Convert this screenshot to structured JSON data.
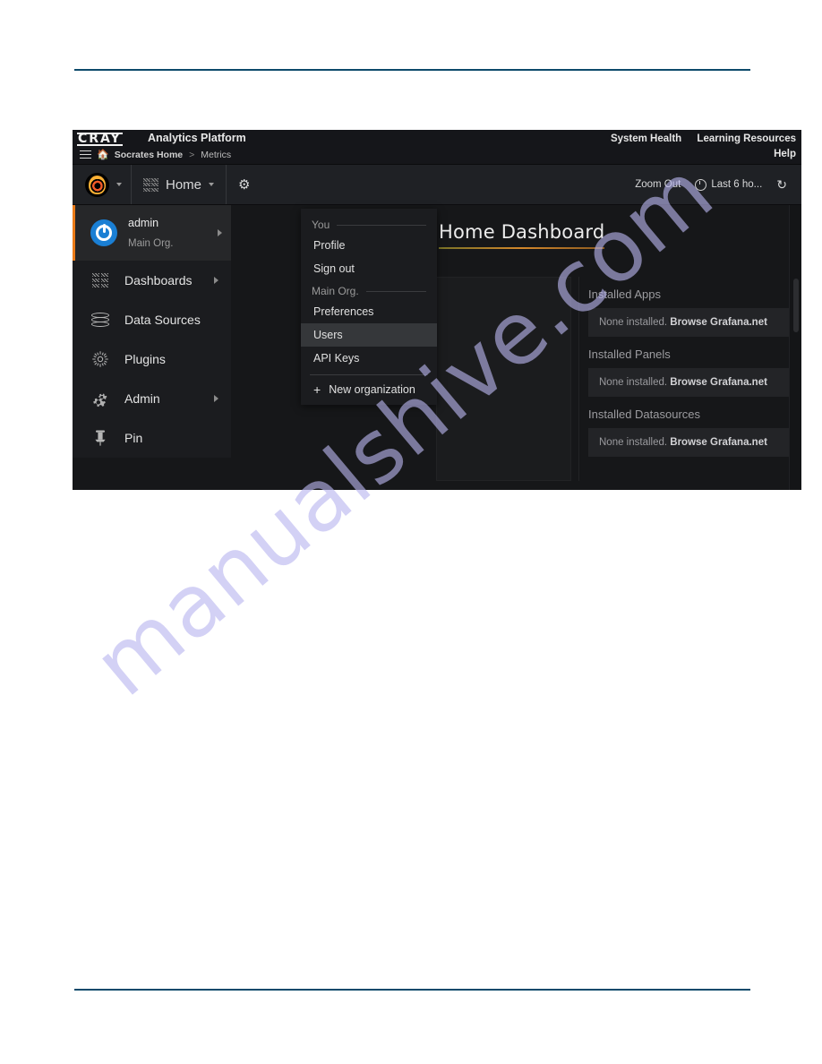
{
  "watermark": {
    "text": "manualshive.com"
  },
  "cray_bar": {
    "logo": "CRAY",
    "product": "Analytics Platform",
    "breadcrumb": {
      "menu_icon": "hamburger-icon",
      "home_icon": "home-icon",
      "home_label": "Socrates Home",
      "separator": ">",
      "current": "Metrics"
    },
    "links": {
      "system_health": "System Health",
      "learning_resources": "Learning Resources",
      "help": "Help"
    }
  },
  "topnav": {
    "logo_icon": "grafana-logo-icon",
    "dashboard_icon": "dashboard-grid-icon",
    "home_label": "Home",
    "settings_icon": "gear-icon",
    "zoom_out_label": "Zoom Out",
    "time_range_icon": "clock-icon",
    "time_range_label": "Last 6 ho...",
    "refresh_icon": "refresh-icon"
  },
  "sidebar": {
    "user": {
      "avatar_icon": "user-avatar-icon",
      "name": "admin",
      "org": "Main Org."
    },
    "items": [
      {
        "label": "Dashboards",
        "icon": "dashboards-icon",
        "has_submenu": true
      },
      {
        "label": "Data Sources",
        "icon": "database-icon",
        "has_submenu": false
      },
      {
        "label": "Plugins",
        "icon": "plugins-icon",
        "has_submenu": false
      },
      {
        "label": "Admin",
        "icon": "gears-icon",
        "has_submenu": true
      },
      {
        "label": "Pin",
        "icon": "pin-icon",
        "has_submenu": false
      }
    ]
  },
  "dropdown": {
    "section_you": "You",
    "you_items": [
      {
        "label": "Profile",
        "active": false
      },
      {
        "label": "Sign out",
        "active": false
      }
    ],
    "section_org": "Main Org.",
    "org_items": [
      {
        "label": "Preferences",
        "active": false
      },
      {
        "label": "Users",
        "active": true
      },
      {
        "label": "API Keys",
        "active": false
      }
    ],
    "new_org": {
      "icon": "plus-icon",
      "label": "New organization"
    }
  },
  "main": {
    "dashboard_title": "Home Dashboard",
    "plugin_sections": [
      {
        "heading": "Installed Apps",
        "empty_text": "None installed.",
        "link_text": "Browse Grafana.net"
      },
      {
        "heading": "Installed Panels",
        "empty_text": "None installed.",
        "link_text": "Browse Grafana.net"
      },
      {
        "heading": "Installed Datasources",
        "empty_text": "None installed.",
        "link_text": "Browse Grafana.net"
      }
    ]
  },
  "colors": {
    "page_rule": "#0d4a6b",
    "accent_orange": "#eb7b18",
    "panel_bg": "#161719",
    "sidebar_bg": "#1b1c1f",
    "avatar_blue": "#1a7fd4"
  }
}
